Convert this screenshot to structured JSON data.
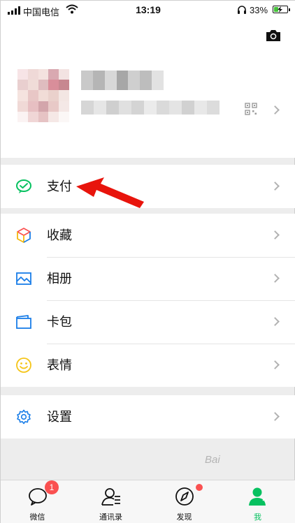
{
  "status_bar": {
    "carrier": "中国电信",
    "time": "13:19",
    "battery": "33%",
    "battery_level": 0.33,
    "battery_color": "#45c23a"
  },
  "profile": {
    "camera_icon": "camera-icon",
    "qrcode_icon": "qrcode-icon",
    "avatar_state": "pixelated",
    "name_state": "pixelated",
    "id_state": "pixelated"
  },
  "menu": {
    "pay": {
      "label": "支付",
      "icon": "wechat-pay-icon",
      "color": "#07c160"
    },
    "favorites": {
      "label": "收藏",
      "icon": "cube-icon"
    },
    "album": {
      "label": "相册",
      "icon": "image-icon",
      "color": "#1a7ee8"
    },
    "cards": {
      "label": "卡包",
      "icon": "card-wallet-icon",
      "color": "#1a7ee8"
    },
    "stickers": {
      "label": "表情",
      "icon": "smiley-icon",
      "color": "#f5c518"
    },
    "settings": {
      "label": "设置",
      "icon": "gear-icon",
      "color": "#1a7ee8"
    }
  },
  "annotation": {
    "type": "red-arrow",
    "points_to": "支付",
    "color": "#e8140c"
  },
  "tabbar": {
    "tabs": [
      {
        "label": "微信",
        "icon": "chat-bubble-icon",
        "badge": "1"
      },
      {
        "label": "通讯录",
        "icon": "contacts-icon"
      },
      {
        "label": "发现",
        "icon": "compass-icon",
        "dot": true
      },
      {
        "label": "我",
        "icon": "person-icon",
        "active": true
      }
    ],
    "active_color": "#07c160"
  },
  "watermark": "Bai"
}
